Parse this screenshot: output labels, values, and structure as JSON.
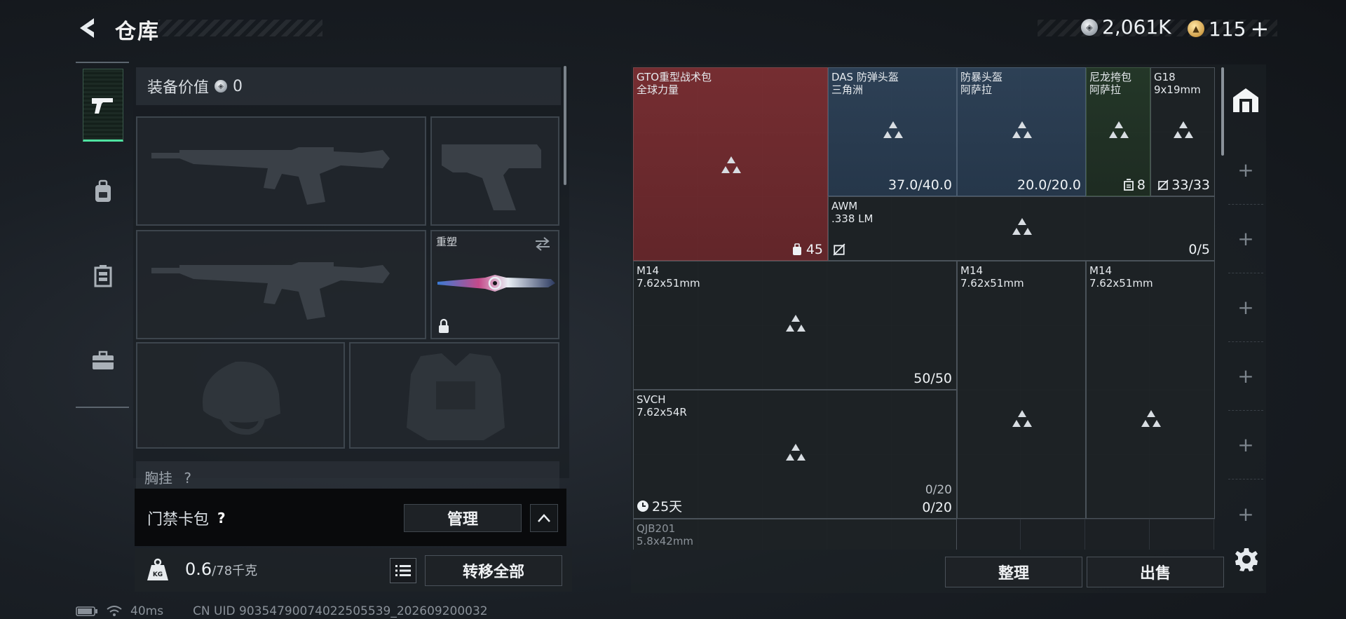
{
  "header": {
    "title": "仓库"
  },
  "currency": {
    "silver_amount": "2,061K",
    "gold_amount": "115",
    "gold_plus": "+"
  },
  "rail": {
    "items": [
      {
        "name": "weapons",
        "icon": "pistol-icon",
        "active": true
      },
      {
        "name": "backpack",
        "icon": "backpack-icon",
        "active": false
      },
      {
        "name": "rig",
        "icon": "chest-rig-icon",
        "active": false
      },
      {
        "name": "toolbox",
        "icon": "briefcase-icon",
        "active": false
      }
    ]
  },
  "loadout": {
    "value_label": "装备价值",
    "value_amount": "0",
    "melee_label": "重塑",
    "chest_label": "胸挂",
    "chest_help": "?"
  },
  "access_card": {
    "label": "门禁卡包",
    "help": "?",
    "manage_label": "管理"
  },
  "weight": {
    "current": "0.6",
    "max": "/78千克",
    "transfer_label": "转移全部"
  },
  "storage": {
    "items": [
      {
        "name": "GTO重型战术包",
        "sub": "全球力量",
        "stat": "45"
      },
      {
        "name": "DAS 防弹头盔",
        "sub": "三角洲",
        "stat": "37.0/40.0"
      },
      {
        "name": "防暴头盔",
        "sub": "阿萨拉",
        "stat": "20.0/20.0"
      },
      {
        "name": "尼龙挎包",
        "sub": "阿萨拉",
        "stat": "8"
      },
      {
        "name": "G18",
        "sub": "9x19mm",
        "stat": "33/33"
      },
      {
        "name": "AWM",
        "sub": ".338 LM",
        "stat": "0/5"
      },
      {
        "name": "M14",
        "sub": "7.62x51mm",
        "stat": "50/50"
      },
      {
        "name": "M14",
        "sub": "7.62x51mm",
        "stat": ""
      },
      {
        "name": "M14",
        "sub": "7.62x51mm",
        "stat": ""
      },
      {
        "name": "SVCH",
        "sub": "7.62x54R",
        "stat": "0/20",
        "stat2": "0/20",
        "timer": "25天"
      },
      {
        "name": "QJB201",
        "sub": "5.8x42mm",
        "stat": ""
      }
    ],
    "sort_label": "整理",
    "sell_label": "出售"
  },
  "status_bar": {
    "ping": "40ms",
    "uid": "CN UID 90354790074022505539_202609200032"
  }
}
